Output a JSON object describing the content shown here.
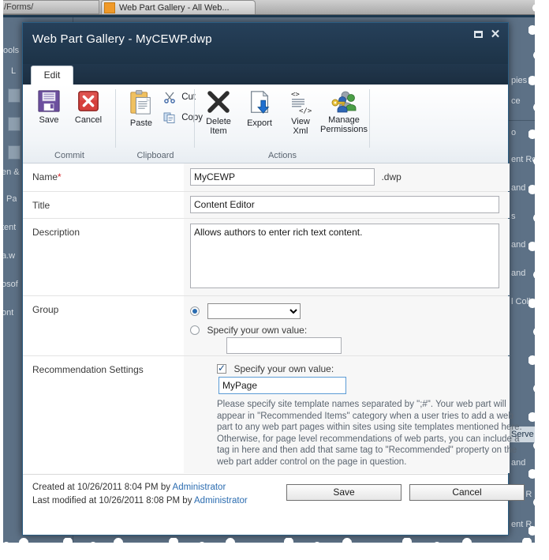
{
  "background": {
    "browser_tab_title": "Web Part Gallery - All Web...",
    "url_bar_text": "/Forms/",
    "left_items": [
      "ools",
      "L",
      "en &",
      "Pa",
      "tent",
      "a.w",
      "osof",
      "ont"
    ],
    "right_items": [
      "pies",
      "ce",
      "o",
      "ent Ro",
      " and",
      "s",
      " and",
      " and",
      "l Coll",
      "Serve",
      " and",
      "ent R"
    ]
  },
  "dialog": {
    "title": "Web Part Gallery - MyCEWP.dwp",
    "maximize_label": "Maximize",
    "close_label": "Close"
  },
  "ribbon": {
    "tabs": [
      {
        "label": "Edit",
        "active": true
      }
    ],
    "groups": [
      {
        "name": "Commit",
        "buttons": [
          {
            "label": "Save",
            "icon": "save-icon"
          },
          {
            "label": "Cancel",
            "icon": "cancel-icon"
          }
        ]
      },
      {
        "name": "Clipboard",
        "buttons": [
          {
            "label": "Paste",
            "icon": "paste-icon"
          }
        ],
        "small_buttons": [
          {
            "label": "Cut",
            "icon": "scissors-icon"
          },
          {
            "label": "Copy",
            "icon": "copy-icon"
          }
        ]
      },
      {
        "name": "Actions",
        "buttons": [
          {
            "label": "Delete Item",
            "line1": "Delete",
            "line2": "Item",
            "icon": "delete-x-icon"
          },
          {
            "label": "Export",
            "line1": "Export",
            "line2": "",
            "icon": "export-icon"
          },
          {
            "label": "View Xml",
            "line1": "View",
            "line2": "Xml",
            "icon": "view-xml-icon"
          },
          {
            "label": "Manage Permissions",
            "line1": "Manage",
            "line2": "Permissions",
            "icon": "manage-permissions-icon"
          }
        ]
      }
    ]
  },
  "form": {
    "name": {
      "label": "Name",
      "required_marker": "*",
      "value": "MyCEWP",
      "suffix": ".dwp"
    },
    "title": {
      "label": "Title",
      "value": "Content Editor"
    },
    "description": {
      "label": "Description",
      "value": "Allows authors to enter rich text content."
    },
    "group": {
      "label": "Group",
      "dropdown_value": "",
      "dropdown_options": [
        ""
      ],
      "specify_label": "Specify your own value:",
      "specify_value": "",
      "selected_option": "dropdown"
    },
    "recommendation": {
      "label": "Recommendation Settings",
      "specify_label": "Specify your own value:",
      "checked": true,
      "value": "MyPage",
      "help_text": "Please specify site template names separated by \";#\". Your web part will appear in \"Recommended Items\" category when a user tries to add a web part to any web part pages within sites using site templates mentioned here. Otherwise, for page level recommendations of web parts, you can include a tag in here and then add that same tag to \"Recommended\" property on the web part adder control on the page in question."
    }
  },
  "footer": {
    "created_prefix": "Created at 10/26/2011 8:04 PM by ",
    "created_user": "Administrator",
    "modified_prefix": "Last modified at 10/26/2011 8:08 PM by ",
    "modified_user": "Administrator",
    "save_label": "Save",
    "cancel_label": "Cancel"
  },
  "colors": {
    "titlebar": "#26405a",
    "accent_link": "#2b6cb0",
    "required": "#d8252b",
    "page_bg": "#5d7186"
  }
}
